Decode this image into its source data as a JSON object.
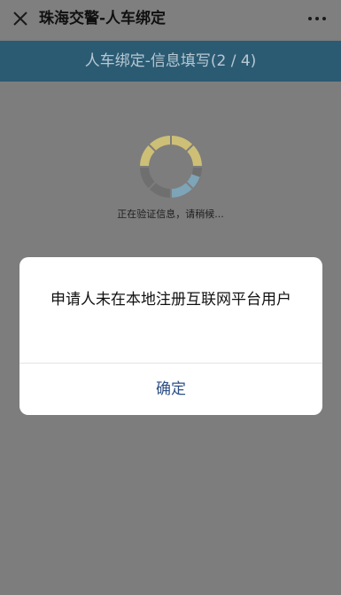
{
  "window": {
    "title": "珠海交警-人车绑定",
    "close_icon": "close-icon",
    "more_icon": "more-dots-icon"
  },
  "header": {
    "title": "人车绑定-信息填写(2 / 4)"
  },
  "loading": {
    "text": "正在验证信息，请稍候..."
  },
  "dialog": {
    "message": "申请人未在本地注册互联网平台用户",
    "confirm_label": "确定"
  },
  "colors": {
    "header_bar": "#2b5b73",
    "confirm_text": "#2d4f86",
    "spinner_yellow": "#d8c779",
    "spinner_blue": "#7fa5b9"
  }
}
